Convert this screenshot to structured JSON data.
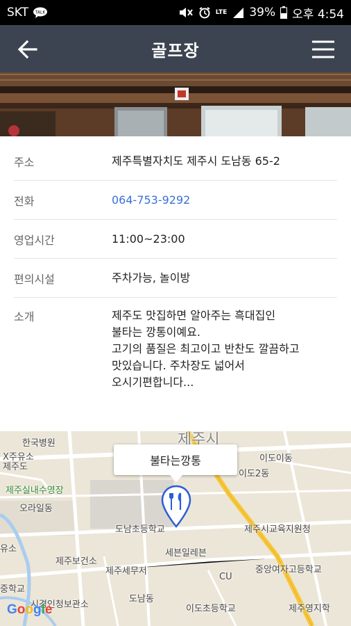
{
  "status_bar": {
    "carrier": "SKT",
    "network": "LTE",
    "battery": "39%",
    "time": "오후 4:54"
  },
  "app_bar": {
    "title": "골프장",
    "back_icon": "arrow-left-icon",
    "menu_icon": "hamburger-menu-icon"
  },
  "details": {
    "address": {
      "label": "주소",
      "value": "제주특별자치도 제주시 도남동 65-2"
    },
    "phone": {
      "label": "전화",
      "value": "064-753-9292"
    },
    "hours": {
      "label": "영업시간",
      "value": "11:00~23:00"
    },
    "amenities": {
      "label": "편의시설",
      "value": "주차가능, 놀이방"
    },
    "intro": {
      "label": "소개",
      "lines": [
        "제주도 맛집하면 알아주는 흑대집인",
        "불타는 깡통이예요.",
        "고기의 품질은 최고이고 반찬도 깔끔하고",
        "맛있습니다. 주차장도 넓어서",
        "오시기편합니다..."
      ]
    }
  },
  "map": {
    "callout": "불타는깡통",
    "pin_icon": "restaurant-pin-icon",
    "provider": "Google",
    "labels": {
      "city": "제주시",
      "hospital": "한국병원",
      "pool": "제주실내수영장",
      "oraildong": "오라일동",
      "idoidong": "이도이동",
      "ido2": "이도2동",
      "donam_school": "도남초등학교",
      "education_office": "제주시교육지원청",
      "seven_eleven": "세븐일레븐",
      "health_center": "제주보건소",
      "tax_office": "제주세무서",
      "girls_high": "중앙여자고등학교",
      "cu": "CU",
      "donamdong": "도남동",
      "ido_school": "이도초등학교",
      "jeju_youngji": "제주영지학",
      "jeju_school": "제주도",
      "xjeju": "X주유소",
      "yuso": "유소",
      "middle_school": "중학교",
      "observation": "시경인청보관소"
    }
  }
}
